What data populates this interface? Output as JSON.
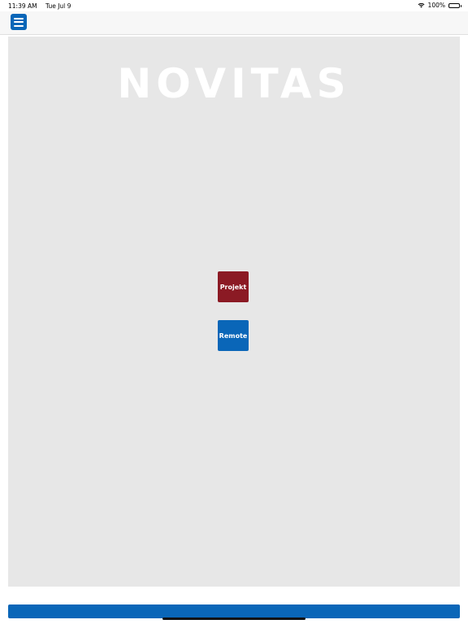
{
  "status_bar": {
    "time": "11:39 AM",
    "date": "Tue Jul 9",
    "battery_text": "100%",
    "wifi_icon": "wifi-icon",
    "battery_icon": "battery-icon"
  },
  "nav": {
    "menu_icon": "hamburger-menu-icon"
  },
  "main": {
    "logo_text": "NOVITAS",
    "buttons": [
      {
        "label": "Projekt",
        "color": "#8b1a24"
      },
      {
        "label": "Remote",
        "color": "#0a66b8"
      }
    ]
  },
  "colors": {
    "accent_blue": "#0a66b8",
    "accent_red": "#8b1a24",
    "panel_bg": "#e7e7e7"
  }
}
